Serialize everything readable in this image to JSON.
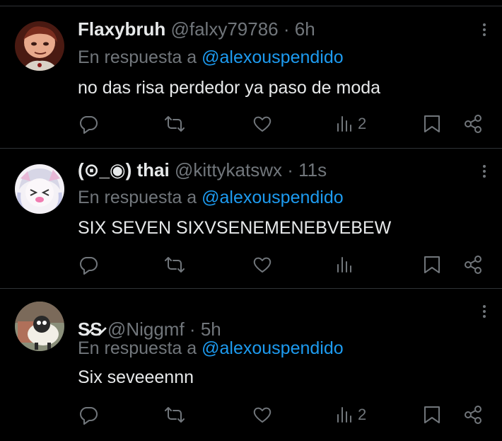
{
  "tweets": [
    {
      "display_name": "Flaxybruh",
      "handle": "@falxy79786",
      "separator": "·",
      "time": "6h",
      "reply_prefix": "En respuesta a",
      "reply_to": "@alexouspendido",
      "text": "no das risa perdedor ya paso de moda",
      "views": "2"
    },
    {
      "display_name": "(⊙_◉) thai",
      "handle": "@kittykatswx",
      "separator": "·",
      "time": "11s",
      "reply_prefix": "En respuesta a",
      "reply_to": "@alexouspendido",
      "text": "SIX SEVEN SIXVSENEMENEBVEBEW",
      "views": ""
    },
    {
      "display_name": "S̷S̷",
      "handle": "@Niggmf",
      "separator": "·",
      "time": "5h",
      "reply_prefix": "En respuesta a",
      "reply_to": "@alexouspendido",
      "text": "Six seveeennn",
      "views": "2"
    }
  ],
  "icons": {
    "reply": "reply-icon",
    "retweet": "retweet-icon",
    "like": "heart-icon",
    "views": "views-icon",
    "bookmark": "bookmark-icon",
    "share": "share-icon",
    "more": "more-icon"
  },
  "colors": {
    "background": "#000000",
    "text": "#e7e9ea",
    "muted": "#71767b",
    "link": "#1d9bf0",
    "divider": "#2f3336"
  }
}
